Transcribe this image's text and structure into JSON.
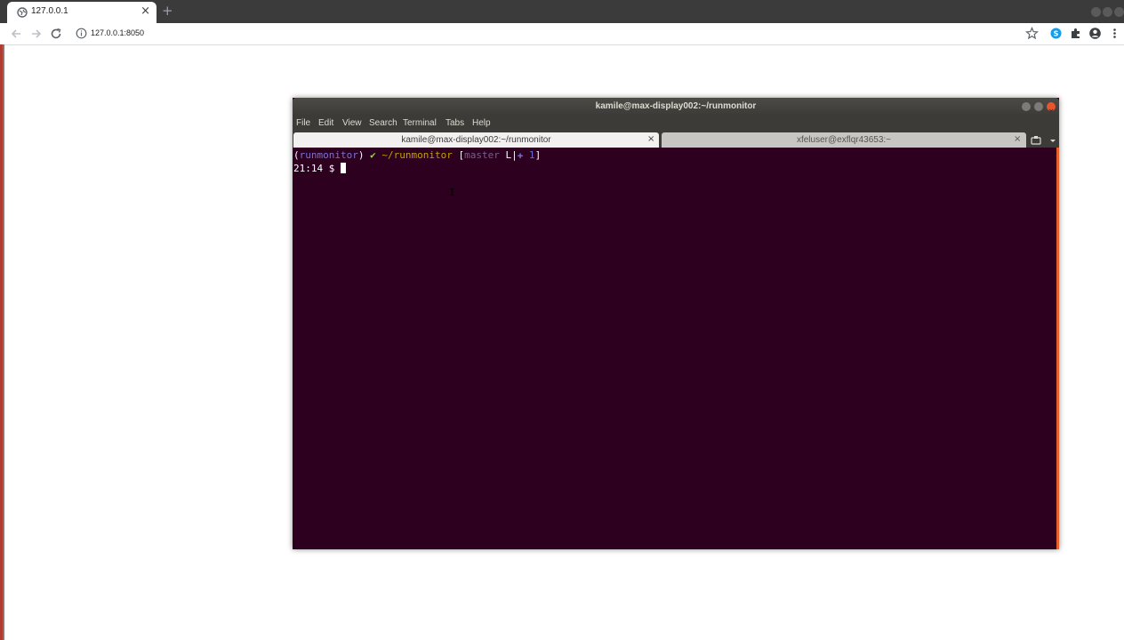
{
  "browser": {
    "tab_title": "127.0.0.1",
    "tab_close": "×",
    "new_tab": "+",
    "url": "127.0.0.1:8050",
    "icons": [
      "back-arrow-icon",
      "forward-arrow-icon",
      "reload-icon",
      "info-icon",
      "star-icon",
      "skype-icon",
      "extensions-icon",
      "profile-icon",
      "menu-icon"
    ]
  },
  "terminal": {
    "window_title": "kamile@max-display002:~/runmonitor",
    "menu": [
      "File",
      "Edit",
      "View",
      "Search",
      "Terminal",
      "Tabs",
      "Help"
    ],
    "tabs": [
      {
        "label": "kamile@max-display002:~/runmonitor",
        "close": "×",
        "active": true
      },
      {
        "label": "xfeluser@exflqr43653:~",
        "close": "×",
        "active": false
      }
    ],
    "prompt": {
      "open_paren": "(",
      "env": "runmonitor",
      "close_paren": ") ",
      "check": "✔ ",
      "path": "~/runmonitor ",
      "open_bracket": "[",
      "branch": "master ",
      "branch_flag": "L",
      "pipe": "|",
      "changes": "✚ 1",
      "close_bracket": "]",
      "time": "21:14 $ "
    },
    "colors": {
      "background": "#2c001e",
      "env": "#7c72d6",
      "check": "#8ae234",
      "path": "#c4a000",
      "branch": "#7a5f8c",
      "changes": "#6a6ad8",
      "text": "#ffffff"
    }
  }
}
